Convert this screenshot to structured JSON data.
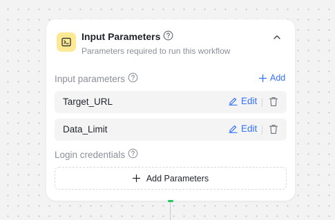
{
  "card": {
    "title": "Input Parameters",
    "subtitle": "Parameters required to run this workflow",
    "header_icon": "terminal-icon",
    "collapse_icon": "chevron-up-icon"
  },
  "input_section": {
    "label": "Input parameters",
    "add_label": "Add",
    "params": [
      {
        "name": "Target_URL",
        "edit_label": "Edit"
      },
      {
        "name": "Data_Limit",
        "edit_label": "Edit"
      }
    ]
  },
  "login_section": {
    "label": "Login credentials",
    "add_button_label": "Add Parameters"
  },
  "colors": {
    "accent": "#3370ff",
    "icon_bg": "#fde994",
    "connector_dot": "#22c55e"
  }
}
